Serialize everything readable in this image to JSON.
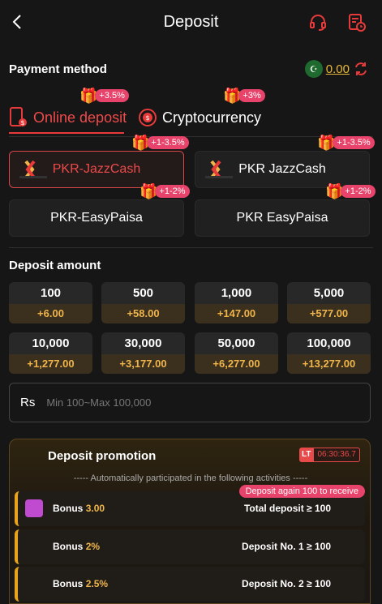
{
  "header": {
    "title": "Deposit"
  },
  "payment": {
    "section_title": "Payment method",
    "currency_symbol": "☪",
    "balance": "0.00",
    "tabs": [
      {
        "label": "Online deposit",
        "badge": "+3.5%"
      },
      {
        "label": "Cryptocurrency",
        "badge": "+3%"
      }
    ],
    "methods": [
      {
        "label": "PKR-JazzCash",
        "badge": "+1-3.5%"
      },
      {
        "label": "PKR JazzCash",
        "badge": "+1-3.5%"
      },
      {
        "label": "PKR-EasyPaisa",
        "badge": "+1-2%"
      },
      {
        "label": "PKR EasyPaisa",
        "badge": "+1-2%"
      }
    ]
  },
  "deposit": {
    "section_title": "Deposit amount",
    "amounts": [
      {
        "value": "100",
        "bonus": "+6.00"
      },
      {
        "value": "500",
        "bonus": "+58.00"
      },
      {
        "value": "1,000",
        "bonus": "+147.00"
      },
      {
        "value": "5,000",
        "bonus": "+577.00"
      },
      {
        "value": "10,000",
        "bonus": "+1,277.00"
      },
      {
        "value": "30,000",
        "bonus": "+3,177.00"
      },
      {
        "value": "50,000",
        "bonus": "+6,277.00"
      },
      {
        "value": "100,000",
        "bonus": "+13,277.00"
      }
    ],
    "currency": "Rs",
    "placeholder": "Min 100~Max 100,000"
  },
  "promotion": {
    "title": "Deposit promotion",
    "lt_label": "LT",
    "countdown": "06:30:36.7",
    "subtitle": "----- Automatically participated in the following activities -----",
    "again_badge": "Deposit again 100 to receive",
    "rows": [
      {
        "label": "Bonus",
        "value": "3.00",
        "condition": "Total deposit ≥ 100"
      },
      {
        "label": "Bonus",
        "value": "2%",
        "condition": "Deposit No. 1 ≥ 100"
      },
      {
        "label": "Bonus",
        "value": "2.5%",
        "condition": "Deposit No. 2 ≥ 100"
      }
    ]
  },
  "colors": {
    "accent_red": "#e83a3a",
    "gold": "#f0b54a",
    "badge_pink": "#e8436b"
  }
}
